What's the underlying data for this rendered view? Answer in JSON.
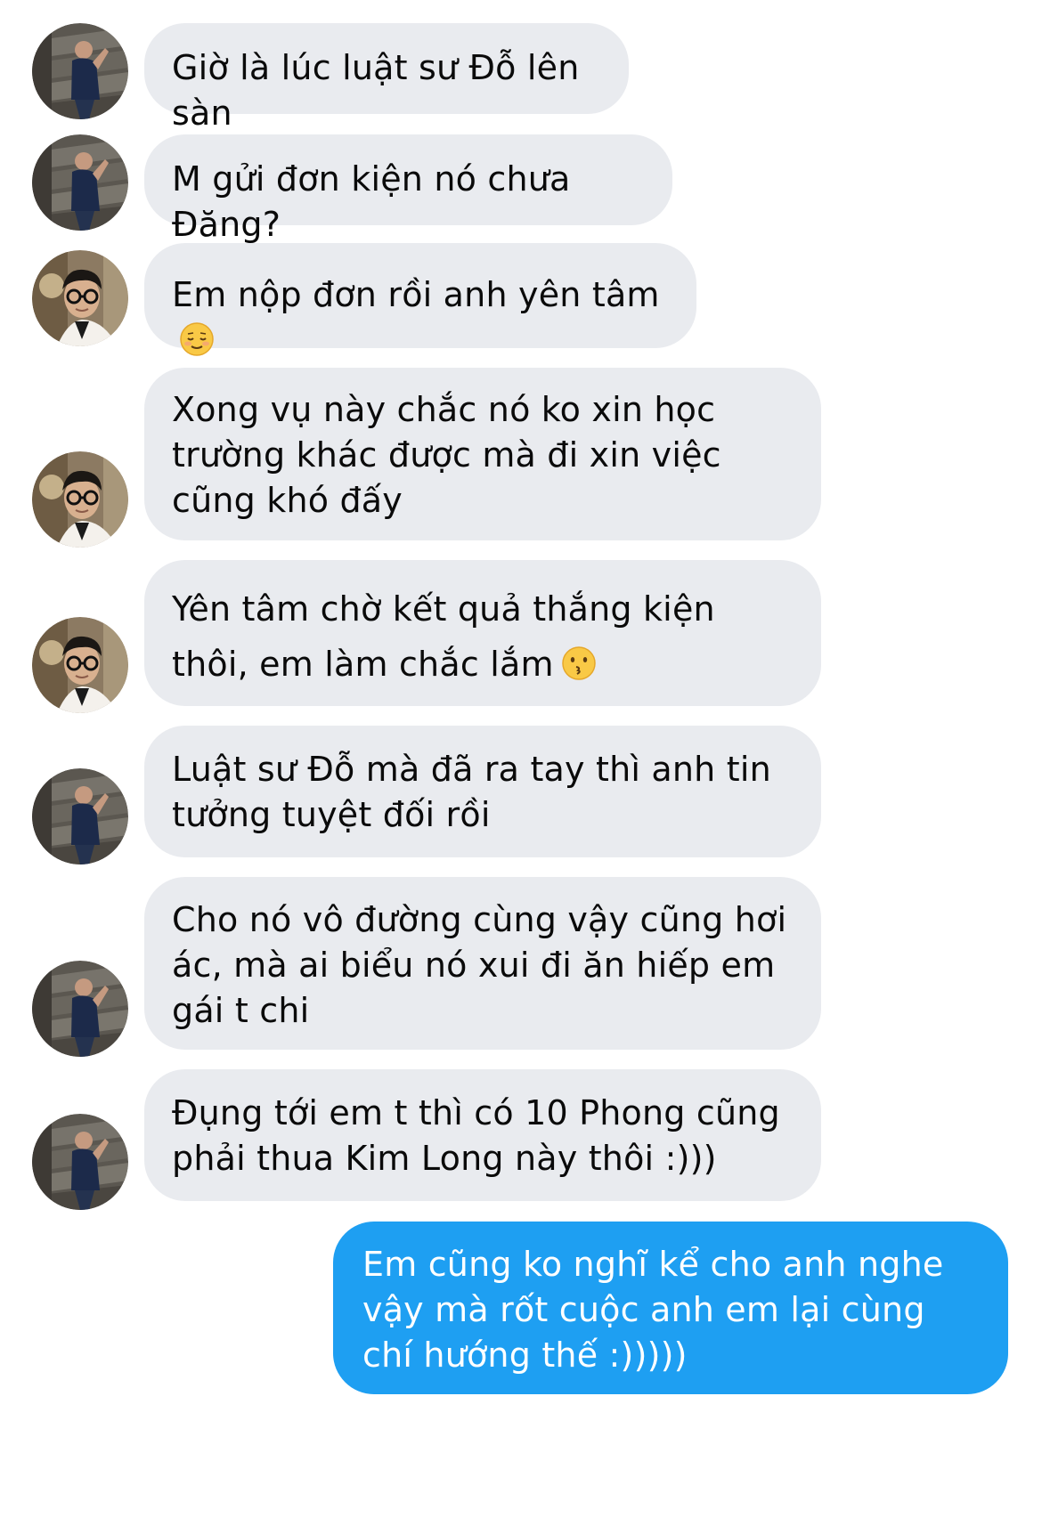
{
  "messages": [
    {
      "sender": "kimlong",
      "text": "Giờ là lúc luật sư Đỗ lên sàn",
      "emoji": null
    },
    {
      "sender": "kimlong",
      "text": "M gửi đơn kiện nó chưa Đăng?",
      "emoji": null
    },
    {
      "sender": "dang",
      "text": "Em nộp đơn rồi anh yên tâm",
      "emoji": "relieved-face-emoji"
    },
    {
      "sender": "dang",
      "text": "Xong vụ này chắc nó ko xin học trường khác được mà đi xin việc cũng khó đấy",
      "emoji": null
    },
    {
      "sender": "dang",
      "text": "Yên tâm chờ kết quả thắng kiện thôi, em làm chắc lắm",
      "emoji": "kissing-face-emoji"
    },
    {
      "sender": "kimlong",
      "text": "Luật sư Đỗ mà đã ra tay thì anh tin tưởng tuyệt đối rồi",
      "emoji": null
    },
    {
      "sender": "kimlong",
      "text": "Cho nó vô đường cùng vậy cũng hơi ác, mà ai biểu nó xui đi ăn hiếp em gái t chi",
      "emoji": null
    },
    {
      "sender": "kimlong",
      "text": "Đụng tới em t thì có 10 Phong cũng phải thua Kim Long này thôi :)))",
      "emoji": null
    },
    {
      "sender": "me",
      "text": "Em cũng ko nghĩ kể cho anh nghe vậy mà rốt cuộc anh em lại cùng chí hướng thế :)))))",
      "emoji": null
    }
  ],
  "colors": {
    "incoming_bubble": "#e9ebef",
    "outgoing_bubble": "#1e9ff2",
    "incoming_text": "#0a0a0a",
    "outgoing_text": "#ffffff"
  }
}
